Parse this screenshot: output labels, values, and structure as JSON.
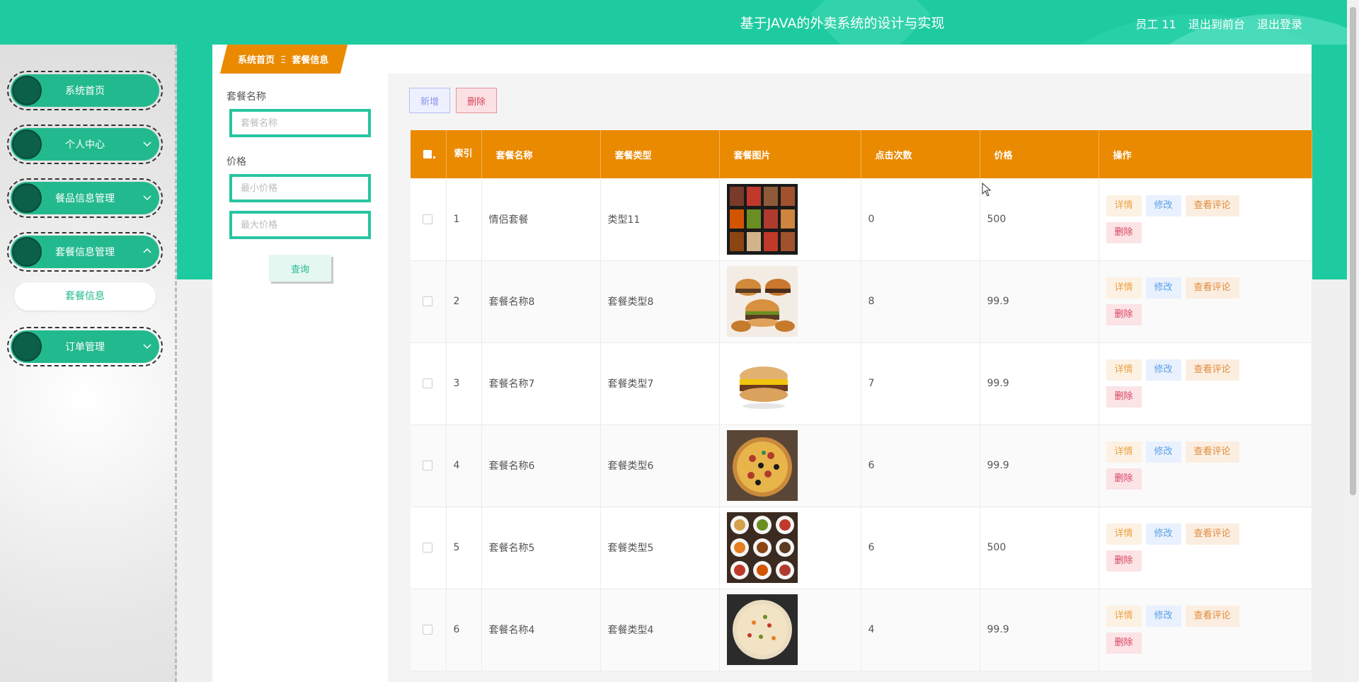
{
  "header": {
    "title": "基于JAVA的外卖系统的设计与实现",
    "user": "员工 11",
    "to_front": "退出到前台",
    "logout": "退出登录"
  },
  "sidebar": {
    "items": [
      {
        "label": "系统首页",
        "icon": "none"
      },
      {
        "label": "个人中心",
        "icon": "chevron-down-icon"
      },
      {
        "label": "餐品信息管理",
        "icon": "chevron-down-icon"
      },
      {
        "label": "套餐信息管理",
        "icon": "chevron-up-icon"
      },
      {
        "label": "订单管理",
        "icon": "chevron-down-icon"
      }
    ],
    "submenu": {
      "label": "套餐信息"
    }
  },
  "breadcrumb": {
    "home": "系统首页",
    "separator": "Ξ",
    "current": "套餐信息"
  },
  "search": {
    "name_label": "套餐名称",
    "name_placeholder": "套餐名称",
    "price_label": "价格",
    "min_placeholder": "最小价格",
    "max_placeholder": "最大价格",
    "query_label": "查询"
  },
  "toolbar": {
    "add_label": "新增",
    "delete_label": "删除"
  },
  "table": {
    "headers": {
      "index": "索引",
      "name": "套餐名称",
      "type": "套餐类型",
      "image": "套餐图片",
      "clicks": "点击次数",
      "price": "价格",
      "ops": "操作"
    },
    "rows": [
      {
        "index": "1",
        "name": "情侣套餐",
        "type": "类型11",
        "clicks": "0",
        "price": "500",
        "image": "bento-grid"
      },
      {
        "index": "2",
        "name": "套餐名称8",
        "type": "套餐类型8",
        "clicks": "8",
        "price": "99.9",
        "image": "burgers"
      },
      {
        "index": "3",
        "name": "套餐名称7",
        "type": "套餐类型7",
        "clicks": "7",
        "price": "99.9",
        "image": "muffin"
      },
      {
        "index": "4",
        "name": "套餐名称6",
        "type": "套餐类型6",
        "clicks": "6",
        "price": "99.9",
        "image": "pizza"
      },
      {
        "index": "5",
        "name": "套餐名称5",
        "type": "套餐类型5",
        "clicks": "6",
        "price": "500",
        "image": "dishes-grid"
      },
      {
        "index": "6",
        "name": "套餐名称4",
        "type": "套餐类型4",
        "clicks": "4",
        "price": "99.9",
        "image": "fried-rice"
      }
    ],
    "ops": {
      "detail": "详情",
      "edit": "修改",
      "review": "查看评论",
      "delete": "删除"
    }
  },
  "colors": {
    "brand_green": "#1ecba0",
    "sidebar_green": "#23b98e",
    "header_orange": "#ea8a00"
  }
}
